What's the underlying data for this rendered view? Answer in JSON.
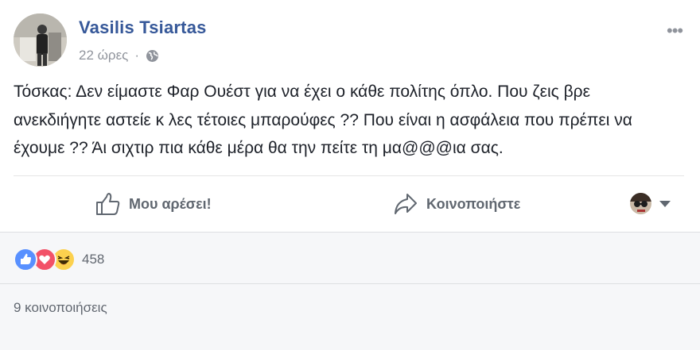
{
  "post": {
    "author": "Vasilis Tsiartas",
    "timestamp": "22 ώρες",
    "separator": "·",
    "privacy_icon": "globe-icon",
    "more_label": "•••",
    "text": "Τόσκας: Δεν είμαστε Φαρ Ουέστ για να έχει ο κάθε πολίτης όπλο. Που ζεις βρε ανεκδιήγητε αστείε κ λες τέτοιες μπαρούφες ?? Που είναι η ασφάλεια που πρέπει να έχουμε ?? Άι σιχτιρ πια κάθε μέρα θα την πείτε τη μα@@@ια σας."
  },
  "actions": {
    "like_label": "Μου αρέσει!",
    "like_icon": "thumbs-up-icon",
    "share_label": "Κοινοποιήστε",
    "share_icon": "share-arrow-icon"
  },
  "footer": {
    "reactions": [
      "like-reaction-icon",
      "love-reaction-icon",
      "haha-reaction-icon"
    ],
    "reaction_count": "458",
    "shares_text": "9 κοινοποιήσεις"
  },
  "colors": {
    "author": "#365899",
    "meta": "#90949c",
    "like_blue": "#5890ff",
    "love_red": "#f25268",
    "haha_yellow": "#fcd14e"
  }
}
